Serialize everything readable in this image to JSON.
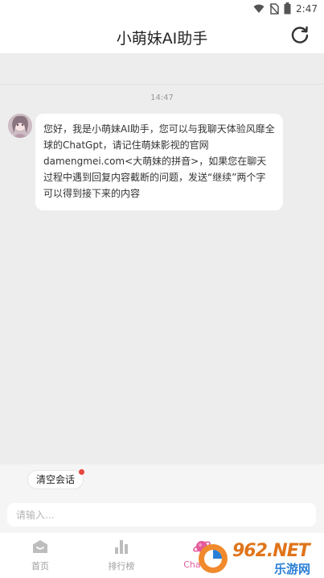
{
  "status_bar": {
    "time": "2:47"
  },
  "header": {
    "title": "小萌妹AI助手",
    "refresh_icon": "refresh-icon"
  },
  "chat": {
    "timestamp": "14:47",
    "messages": [
      {
        "sender": "bot",
        "text": "您好，我是小萌妹AI助手，您可以与我聊天体验风靡全球的ChatGpt，请记住萌妹影视的官网damengmei.com<大萌妹的拼音>，如果您在聊天过程中遇到回复内容截断的问题，发送“继续”两个字可以得到接下来的内容"
      }
    ]
  },
  "clear_button": {
    "label": "清空会话"
  },
  "input": {
    "placeholder": "请输入..."
  },
  "tabs": [
    {
      "label": "首页",
      "icon": "home-icon",
      "active": false
    },
    {
      "label": "排行榜",
      "icon": "bar-chart-icon",
      "active": false
    },
    {
      "label": "ChatGpt",
      "icon": "planet-icon",
      "active": true
    }
  ],
  "watermark": {
    "text": "962.NET",
    "subtext": "乐游网"
  },
  "colors": {
    "accent": "#e45b9c",
    "background": "#ededed",
    "bubble": "#ffffff"
  }
}
